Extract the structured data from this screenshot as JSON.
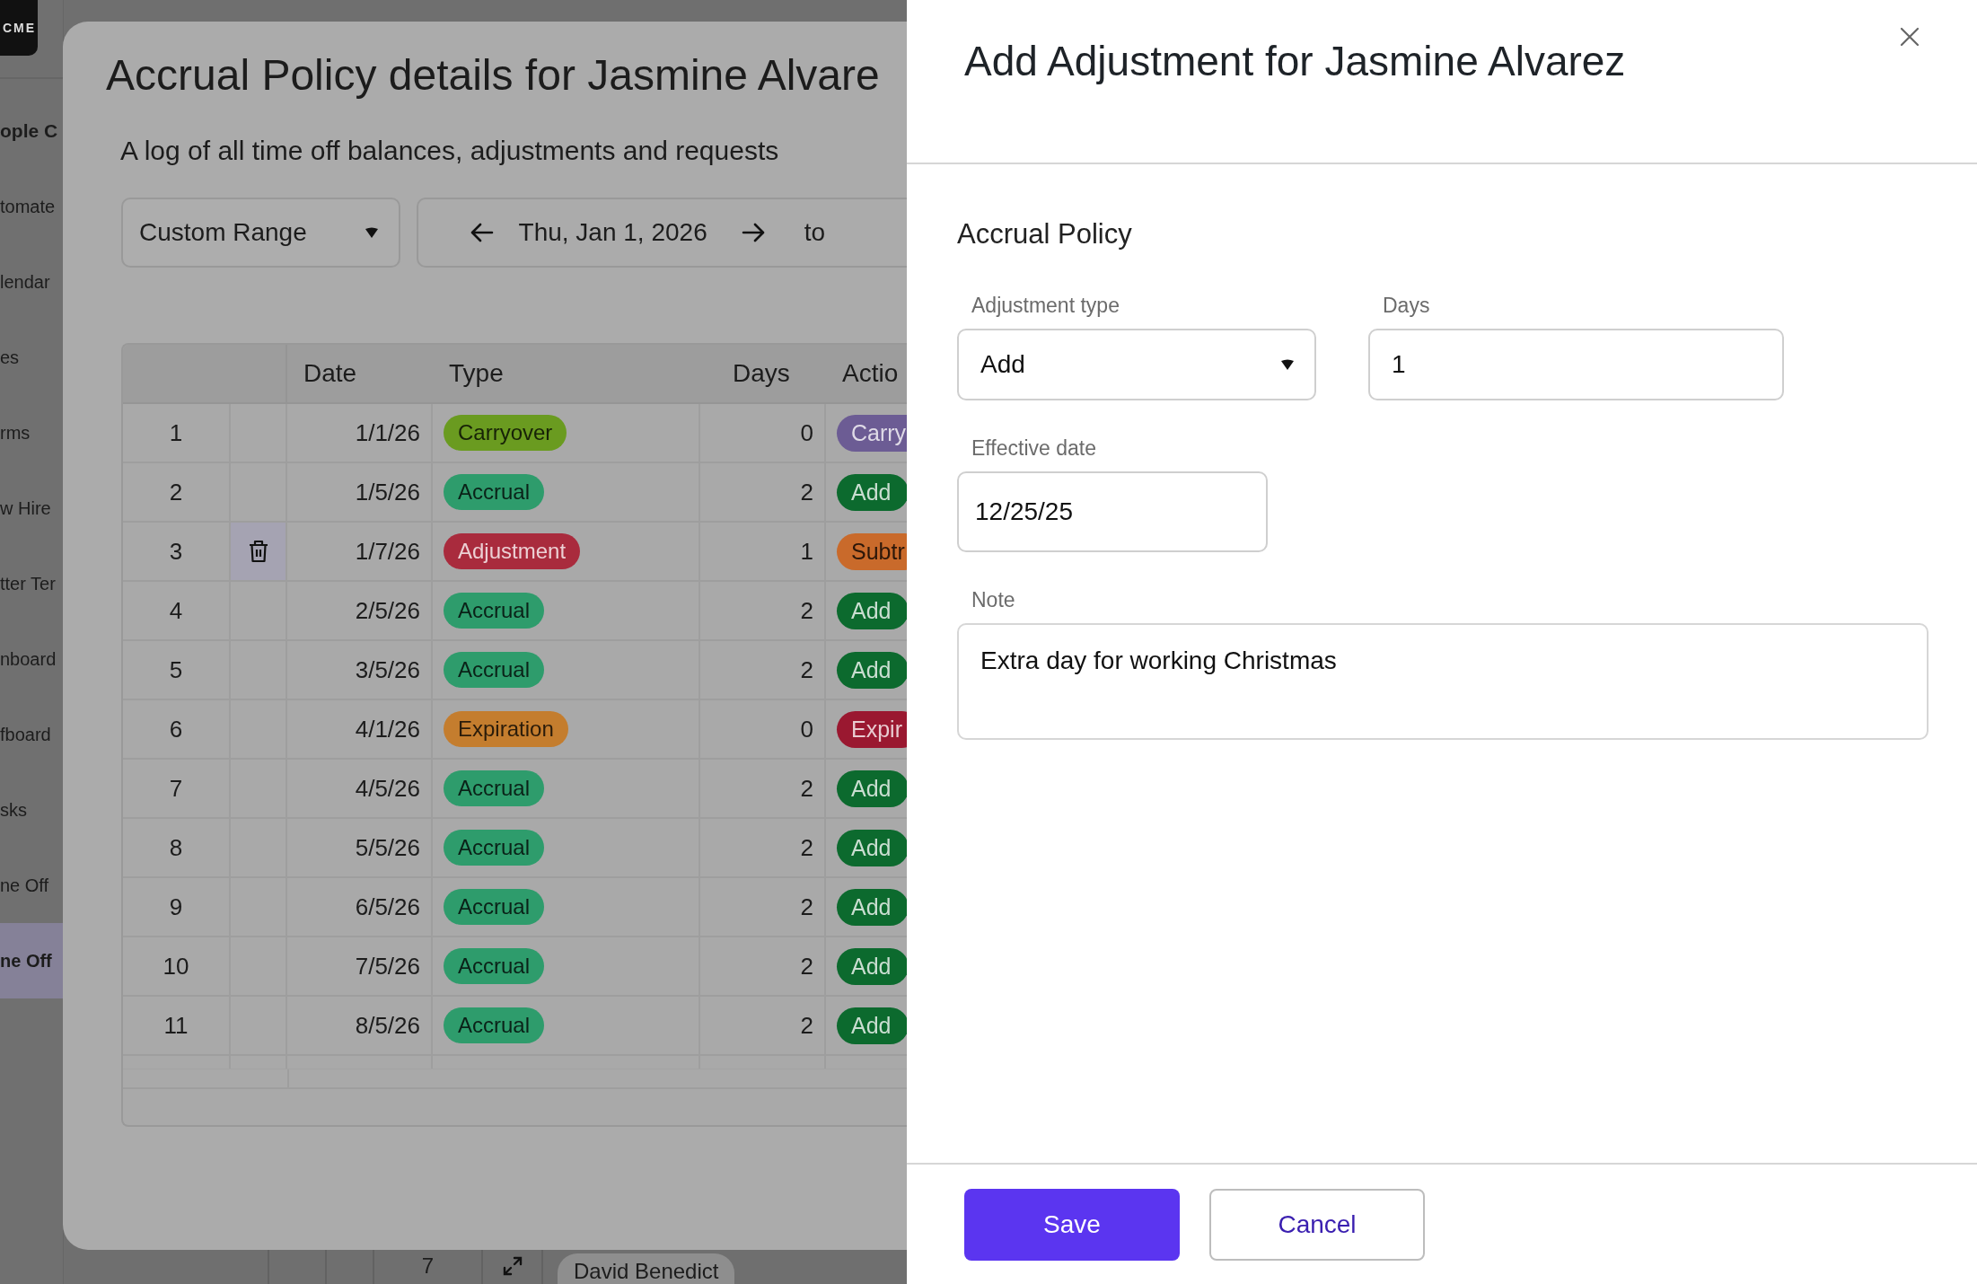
{
  "background_page": {
    "logo": "CME",
    "sidebar": [
      {
        "label": "ople C",
        "kind": "heading",
        "selected": false
      },
      {
        "label": "tomate",
        "kind": "link",
        "selected": false
      },
      {
        "label": "lendar",
        "kind": "link",
        "selected": false
      },
      {
        "label": "es",
        "kind": "link",
        "selected": false
      },
      {
        "label": "rms",
        "kind": "link",
        "selected": false
      },
      {
        "label": "w Hire",
        "kind": "link",
        "selected": false
      },
      {
        "label": "tter Ter",
        "kind": "link",
        "selected": false
      },
      {
        "label": "nboard",
        "kind": "link",
        "selected": false
      },
      {
        "label": "fboard",
        "kind": "link",
        "selected": false
      },
      {
        "label": "sks",
        "kind": "link",
        "selected": false
      },
      {
        "label": "ne Off",
        "kind": "link",
        "selected": false
      },
      {
        "label": "ne Off",
        "kind": "link",
        "selected": true
      }
    ],
    "bottom_row": {
      "number": "7",
      "name": "David Benedict"
    }
  },
  "modal": {
    "title": "Accrual Policy details for Jasmine Alvare",
    "subtitle": "A log of all time off balances, adjustments and requests",
    "range_select": "Custom Range",
    "start_date": "Thu, Jan 1, 2026",
    "to": "to",
    "table": {
      "columns": [
        "Date",
        "Type",
        "Days",
        "Actio"
      ],
      "rows": [
        {
          "number": "1",
          "delete_icon": false,
          "date": "1/1/26",
          "type": {
            "label": "Carryover",
            "color": "#6a9b20"
          },
          "days": "0",
          "action": {
            "label": "Carry",
            "color": "#6c5c94"
          }
        },
        {
          "number": "2",
          "delete_icon": false,
          "date": "1/5/26",
          "type": {
            "label": "Accrual",
            "color": "#2e9c6c"
          },
          "days": "2",
          "action": {
            "label": "Add",
            "color": "#0c6a2e"
          }
        },
        {
          "number": "3",
          "delete_icon": true,
          "date": "1/7/26",
          "type": {
            "label": "Adjustment",
            "color": "#a92b3d"
          },
          "days": "1",
          "action": {
            "label": "Subtr",
            "color": "#c96a2b"
          }
        },
        {
          "number": "4",
          "delete_icon": false,
          "date": "2/5/26",
          "type": {
            "label": "Accrual",
            "color": "#2e9c6c"
          },
          "days": "2",
          "action": {
            "label": "Add",
            "color": "#0c6a2e"
          }
        },
        {
          "number": "5",
          "delete_icon": false,
          "date": "3/5/26",
          "type": {
            "label": "Accrual",
            "color": "#2e9c6c"
          },
          "days": "2",
          "action": {
            "label": "Add",
            "color": "#0c6a2e"
          }
        },
        {
          "number": "6",
          "delete_icon": false,
          "date": "4/1/26",
          "type": {
            "label": "Expiration",
            "color": "#c47d2e"
          },
          "days": "0",
          "action": {
            "label": "Expir",
            "color": "#9a1830"
          }
        },
        {
          "number": "7",
          "delete_icon": false,
          "date": "4/5/26",
          "type": {
            "label": "Accrual",
            "color": "#2e9c6c"
          },
          "days": "2",
          "action": {
            "label": "Add",
            "color": "#0c6a2e"
          }
        },
        {
          "number": "8",
          "delete_icon": false,
          "date": "5/5/26",
          "type": {
            "label": "Accrual",
            "color": "#2e9c6c"
          },
          "days": "2",
          "action": {
            "label": "Add",
            "color": "#0c6a2e"
          }
        },
        {
          "number": "9",
          "delete_icon": false,
          "date": "6/5/26",
          "type": {
            "label": "Accrual",
            "color": "#2e9c6c"
          },
          "days": "2",
          "action": {
            "label": "Add",
            "color": "#0c6a2e"
          }
        },
        {
          "number": "10",
          "delete_icon": false,
          "date": "7/5/26",
          "type": {
            "label": "Accrual",
            "color": "#2e9c6c"
          },
          "days": "2",
          "action": {
            "label": "Add",
            "color": "#0c6a2e"
          }
        },
        {
          "number": "11",
          "delete_icon": false,
          "date": "8/5/26",
          "type": {
            "label": "Accrual",
            "color": "#2e9c6c"
          },
          "days": "2",
          "action": {
            "label": "Add",
            "color": "#0c6a2e"
          }
        }
      ]
    }
  },
  "drawer": {
    "title": "Add Adjustment for Jasmine Alvarez",
    "section": "Accrual Policy",
    "adjustment_type": {
      "label": "Adjustment type",
      "value": "Add"
    },
    "days": {
      "label": "Days",
      "value": "1"
    },
    "effective_date": {
      "label": "Effective date",
      "value": "12/25/25"
    },
    "note": {
      "label": "Note",
      "value": "Extra day for working Christmas"
    },
    "buttons": {
      "save": "Save",
      "cancel": "Cancel"
    }
  }
}
